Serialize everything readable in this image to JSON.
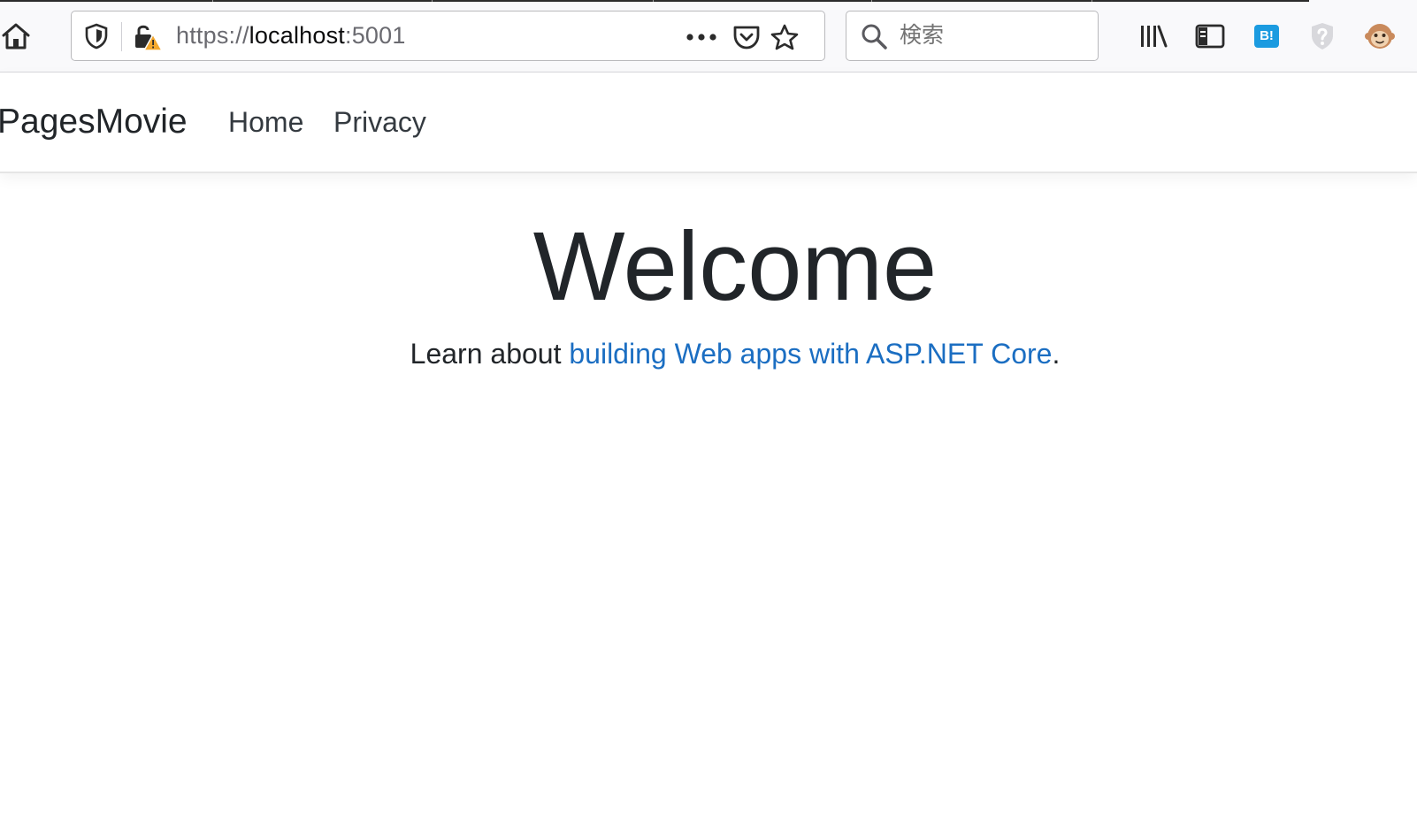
{
  "browser": {
    "url_scheme": "https://",
    "url_host": "localhost",
    "url_port": ":5001",
    "search_placeholder": "検索",
    "hatena_label": "B!",
    "icons": [
      "home-icon",
      "tracking-shield-icon",
      "insecure-lock-icon",
      "page-actions-icon",
      "pocket-icon",
      "bookmark-star-icon",
      "search-icon",
      "library-icon",
      "sidebar-icon",
      "hatena-bookmark-icon",
      "extension-shield-icon",
      "monkey-extension-icon"
    ]
  },
  "navbar": {
    "brand": "PagesMovie",
    "links": [
      {
        "label": "Home"
      },
      {
        "label": "Privacy"
      }
    ]
  },
  "main": {
    "heading": "Welcome",
    "lead_prefix": "Learn about ",
    "lead_link": "building Web apps with ASP.NET Core",
    "lead_suffix": "."
  },
  "colors": {
    "link": "#1b6ec2",
    "text": "#212529",
    "hatena": "#1b9be0"
  }
}
